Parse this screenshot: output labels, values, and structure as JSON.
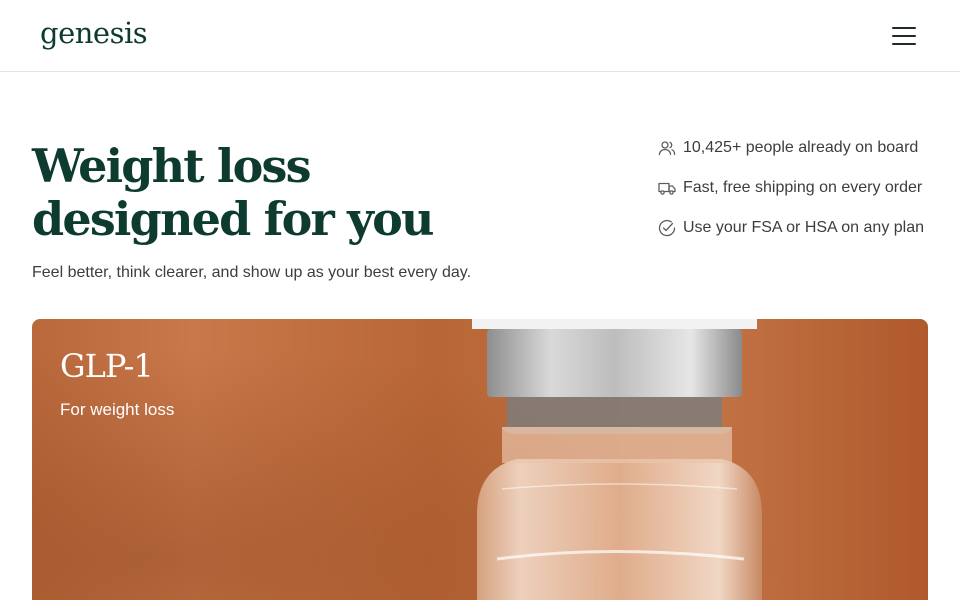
{
  "header": {
    "logo": "genesis",
    "menu_icon": "hamburger-menu-icon"
  },
  "hero": {
    "title_line1": "Weight loss",
    "title_line2": "designed for you",
    "subtitle": "Feel better, think clearer, and show up as your best every day."
  },
  "features": [
    {
      "icon": "people-icon",
      "text": "10,425+ people already on board"
    },
    {
      "icon": "truck-icon",
      "text": "Fast, free shipping on every order"
    },
    {
      "icon": "check-circle-icon",
      "text": "Use your FSA or HSA on any plan"
    }
  ],
  "product_card": {
    "title": "GLP-1",
    "subtitle": "For weight loss",
    "image": "vial-photo"
  },
  "colors": {
    "brand": "#0e3b30",
    "card_bg": "#bb6a3b",
    "text": "#3a3f3d"
  }
}
